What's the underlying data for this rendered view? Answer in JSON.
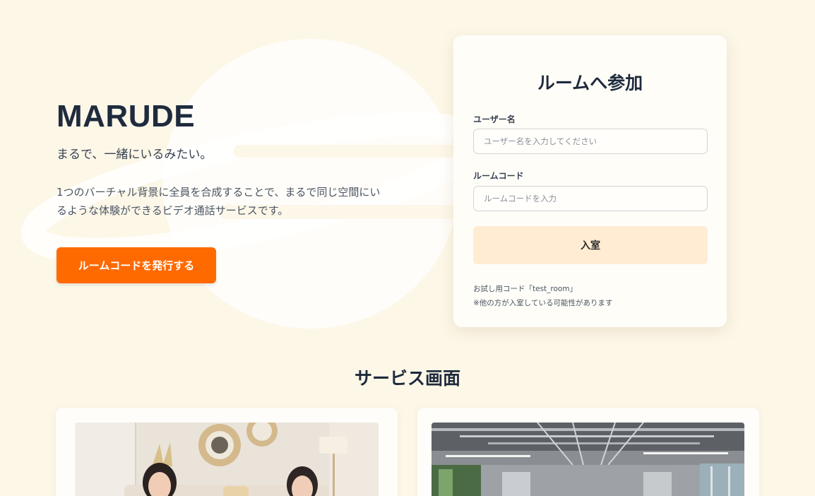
{
  "hero": {
    "brand": "MARUDE",
    "tagline": "まるで、一緒にいるみたい。",
    "description_line1": "1つのバーチャル背景に全員を合成することで、まるで同じ空間にい",
    "description_line2": "るような体験ができるビデオ通話サービスです。",
    "issue_button_label": "ルームコードを発行する"
  },
  "join_form": {
    "title": "ルームへ参加",
    "username_label": "ユーザー名",
    "username_placeholder": "ユーザー名を入力してください",
    "username_value": "",
    "roomcode_label": "ルームコード",
    "roomcode_placeholder": "ルームコードを入力",
    "roomcode_value": "",
    "enter_button_label": "入室",
    "note_line1": "お試し用コード「test_room」",
    "note_line2": "※他の方が入室している可能性があります"
  },
  "services": {
    "title": "サービス画面",
    "screenshots": [
      {
        "icon": "living-room-video-call-image"
      },
      {
        "icon": "office-background-image"
      }
    ]
  },
  "colors": {
    "background": "#fdf7e8",
    "accent": "#ff6a00",
    "enter_button_bg": "#ffecd3",
    "heading": "#1f2b3d"
  }
}
